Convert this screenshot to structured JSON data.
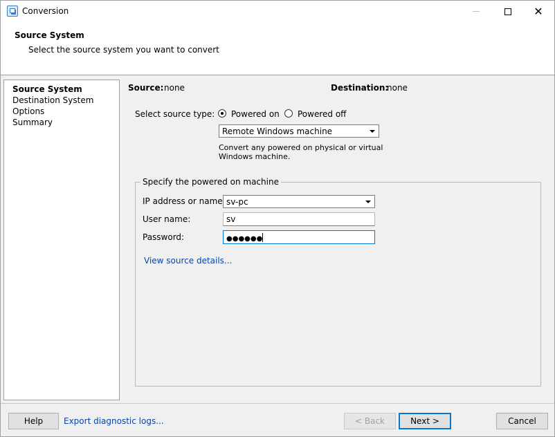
{
  "window": {
    "title": "Conversion"
  },
  "header": {
    "title": "Source System",
    "subtitle": "Select the source system you want to convert"
  },
  "nav": {
    "items": [
      {
        "label": "Source System",
        "active": true
      },
      {
        "label": "Destination System",
        "active": false
      },
      {
        "label": "Options",
        "active": false
      },
      {
        "label": "Summary",
        "active": false
      }
    ]
  },
  "summary": {
    "source_label": "Source:",
    "source_value": "none",
    "destination_label": "Destination:",
    "destination_value": "none"
  },
  "source_type": {
    "label": "Select source type:",
    "options": [
      "Powered on",
      "Powered off"
    ],
    "selected": "Powered on",
    "machine_type": "Remote Windows machine",
    "description_line1": "Convert any powered on physical or virtual",
    "description_line2": "Windows machine."
  },
  "machine": {
    "group_title": "Specify the powered on machine",
    "ip_label": "IP address or name:",
    "ip_value": "sv-pc",
    "user_label": "User name:",
    "user_value": "sv",
    "password_label": "Password:",
    "password_value": "●●●●●●",
    "details_link": "View source details..."
  },
  "footer": {
    "help": "Help",
    "export_logs": "Export diagnostic logs...",
    "back": "< Back",
    "next": "Next >",
    "cancel": "Cancel"
  },
  "colors": {
    "link": "#0645ad",
    "focus": "#0078d7",
    "panel": "#f0f0f0"
  }
}
